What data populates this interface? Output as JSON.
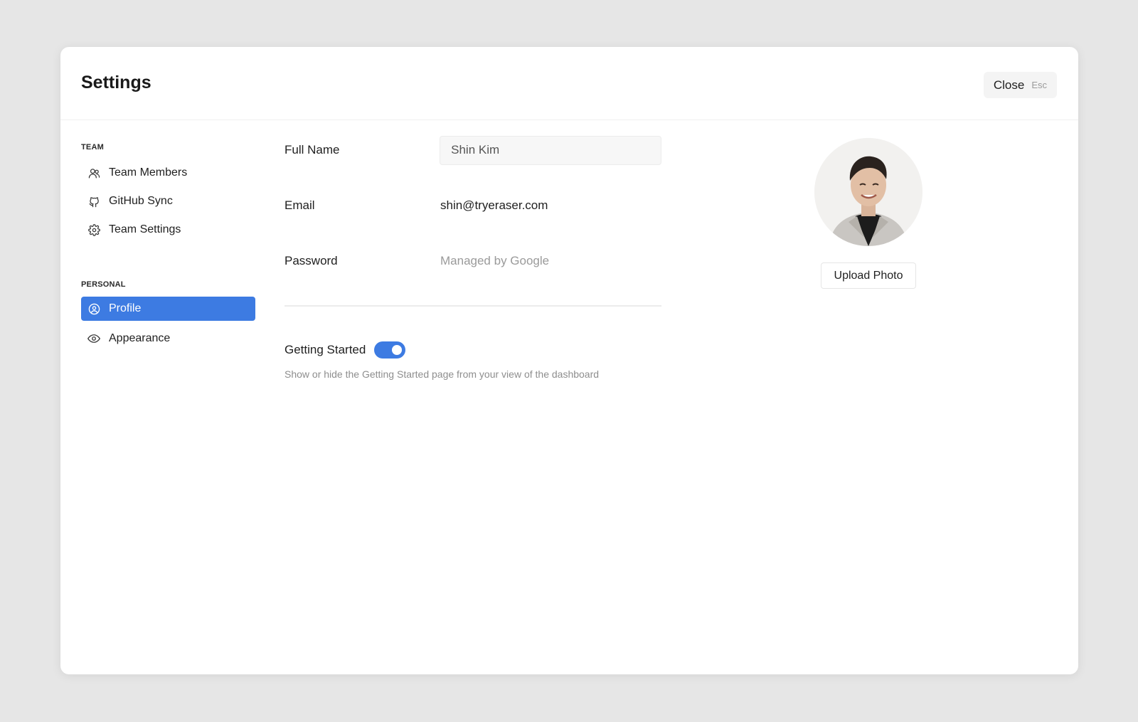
{
  "modal": {
    "title": "Settings",
    "close_label": "Close",
    "close_shortcut": "Esc"
  },
  "sidebar": {
    "team_section": "TEAM",
    "team_items": [
      {
        "label": "Team Members",
        "icon": "team-members-icon"
      },
      {
        "label": "GitHub Sync",
        "icon": "github-icon"
      },
      {
        "label": "Team Settings",
        "icon": "gear-icon"
      }
    ],
    "personal_section": "PERSONAL",
    "personal_items": [
      {
        "label": "Profile",
        "icon": "user-circle-icon",
        "active": true
      },
      {
        "label": "Appearance",
        "icon": "eye-icon",
        "active": false
      }
    ]
  },
  "profile": {
    "full_name_label": "Full Name",
    "full_name_value": "Shin Kim",
    "email_label": "Email",
    "email_value": "shin@tryeraser.com",
    "password_label": "Password",
    "password_value": "Managed by Google",
    "getting_started_label": "Getting Started",
    "getting_started_enabled": true,
    "getting_started_desc": "Show or hide the Getting Started page from your view of the dashboard",
    "upload_photo_label": "Upload Photo"
  },
  "colors": {
    "accent": "#3d7be2",
    "background": "#e6e6e6"
  }
}
